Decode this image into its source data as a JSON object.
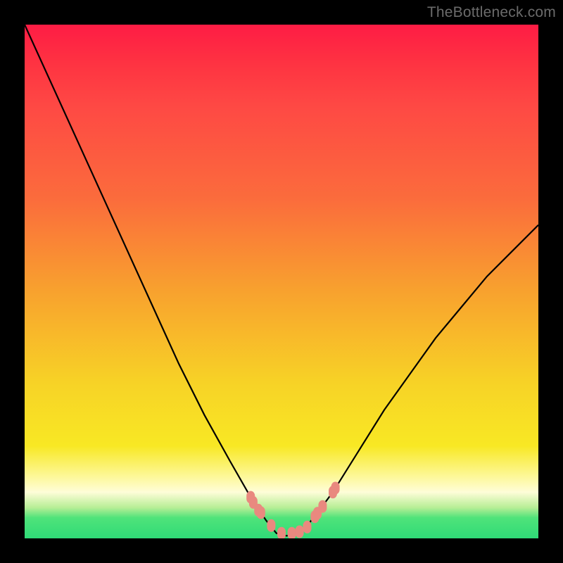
{
  "watermark": "TheBottleneck.com",
  "chart_data": {
    "type": "line",
    "title": "",
    "xlabel": "",
    "ylabel": "",
    "xlim": [
      0,
      100
    ],
    "ylim": [
      0,
      100
    ],
    "series": [
      {
        "name": "curve",
        "x": [
          0,
          5,
          10,
          15,
          20,
          25,
          30,
          35,
          40,
          44,
          47,
          49,
          51,
          53,
          55,
          57,
          60,
          65,
          70,
          75,
          80,
          85,
          90,
          95,
          100
        ],
        "values": [
          100,
          89,
          78,
          67,
          56,
          45,
          34,
          24,
          15,
          8,
          3.5,
          1,
          0.5,
          1,
          2.5,
          5,
          9,
          17,
          25,
          32,
          39,
          45,
          51,
          56,
          61
        ]
      }
    ],
    "markers": {
      "name": "pink-nodes",
      "color": "#e9897f",
      "x": [
        44.0,
        44.5,
        45.5,
        46.0,
        48.0,
        50.0,
        52.0,
        53.5,
        55.0,
        56.5,
        57.0,
        58.0,
        60.0,
        60.5
      ],
      "values": [
        8.0,
        7.0,
        5.5,
        5.0,
        2.5,
        1.0,
        1.0,
        1.3,
        2.2,
        4.2,
        4.9,
        6.2,
        9.0,
        9.8
      ]
    },
    "gradient_stops": [
      {
        "pos": 0.0,
        "color": "#fe1c44"
      },
      {
        "pos": 0.35,
        "color": "#fb6c3c"
      },
      {
        "pos": 0.82,
        "color": "#f8e824"
      },
      {
        "pos": 0.96,
        "color": "#4fe37a"
      },
      {
        "pos": 1.0,
        "color": "#2fdb77"
      }
    ]
  }
}
